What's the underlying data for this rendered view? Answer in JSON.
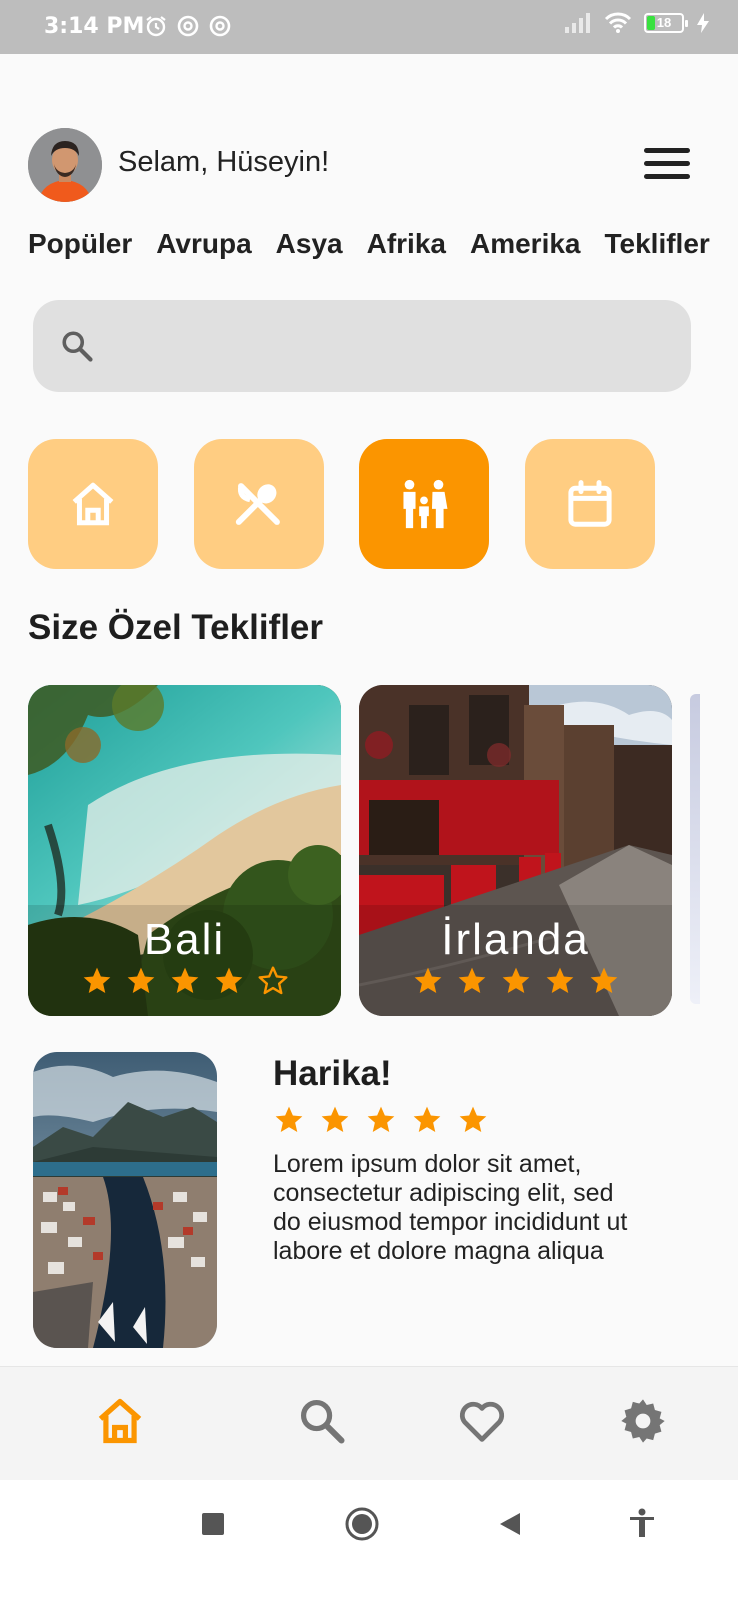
{
  "status_bar": {
    "time": "3:14 PM",
    "battery": "18"
  },
  "header": {
    "greeting": "Selam, Hüseyin!",
    "avatar_icon": "user-avatar",
    "menu_icon": "hamburger-menu-icon"
  },
  "tabs": [
    "Popüler",
    "Avrupa",
    "Asya",
    "Afrika",
    "Amerika",
    "Teklifler"
  ],
  "search": {
    "placeholder": "",
    "icon": "search-icon"
  },
  "categories": [
    {
      "icon": "home-icon",
      "active": false
    },
    {
      "icon": "restaurant-icon",
      "active": false
    },
    {
      "icon": "family-icon",
      "active": true
    },
    {
      "icon": "calendar-icon",
      "active": false
    }
  ],
  "section_title": "Size Özel Teklifler",
  "offers": [
    {
      "name": "Bali",
      "rating": 4
    },
    {
      "name": "İrlanda",
      "rating": 5
    }
  ],
  "review": {
    "title": "Harika!",
    "rating": 5,
    "text": "Lorem ipsum dolor sit amet, consectetur adipiscing elit, sed do eiusmod tempor incididunt ut labore et dolore magna aliqua"
  },
  "bottom_nav": [
    {
      "icon": "home-icon",
      "active": true
    },
    {
      "icon": "search-icon",
      "active": false
    },
    {
      "icon": "heart-icon",
      "active": false
    },
    {
      "icon": "settings-icon",
      "active": false
    }
  ],
  "colors": {
    "accent": "#fb9500",
    "accent_light": "#ffcd82",
    "star": "#fb9500"
  }
}
